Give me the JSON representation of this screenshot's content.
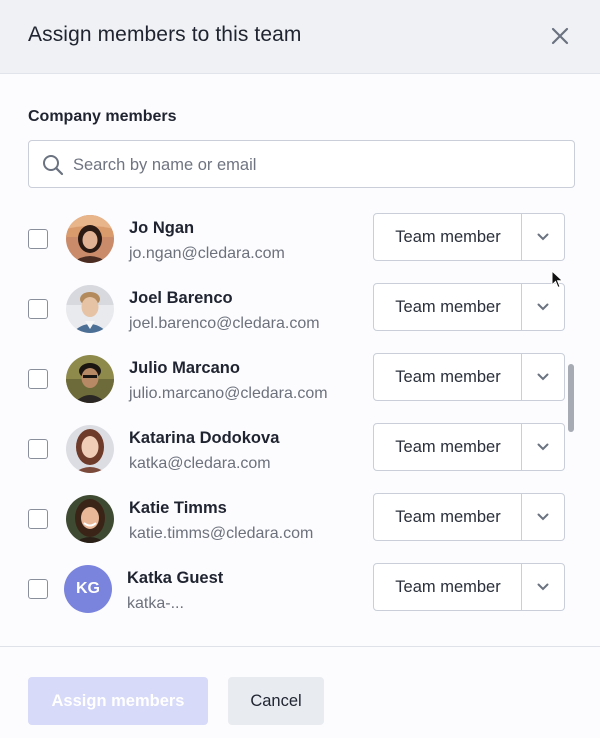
{
  "dialog": {
    "title": "Assign members to this team",
    "close_icon": "close-icon"
  },
  "section_label": "Company members",
  "search": {
    "placeholder": "Search by name or email",
    "value": "",
    "icon": "search-icon"
  },
  "members": [
    {
      "name": "Jo Ngan",
      "email": "jo.ngan@cledara.com",
      "role": "Team member",
      "checked": false,
      "avatar": "photo"
    },
    {
      "name": "Joel Barenco",
      "email": "joel.barenco@cledara.com",
      "role": "Team member",
      "checked": false,
      "avatar": "photo"
    },
    {
      "name": "Julio Marcano",
      "email": "julio.marcano@cledara.com",
      "role": "Team member",
      "checked": false,
      "avatar": "photo"
    },
    {
      "name": "Katarina Dodokova",
      "email": "katka@cledara.com",
      "role": "Team member",
      "checked": false,
      "avatar": "photo"
    },
    {
      "name": "Katie Timms",
      "email": "katie.timms@cledara.com",
      "role": "Team member",
      "checked": false,
      "avatar": "photo"
    },
    {
      "name": "Katka Guest",
      "email": "katka-...",
      "role": "Team member",
      "checked": false,
      "avatar": "initials",
      "initials": "KG"
    }
  ],
  "footer": {
    "assign_label": "Assign members",
    "cancel_label": "Cancel",
    "assign_disabled": true
  },
  "colors": {
    "header_bg": "#eff1f4",
    "primary_disabled": "#d7daf8",
    "initials_avatar": "#7b84dd",
    "border": "#c9ced8"
  }
}
